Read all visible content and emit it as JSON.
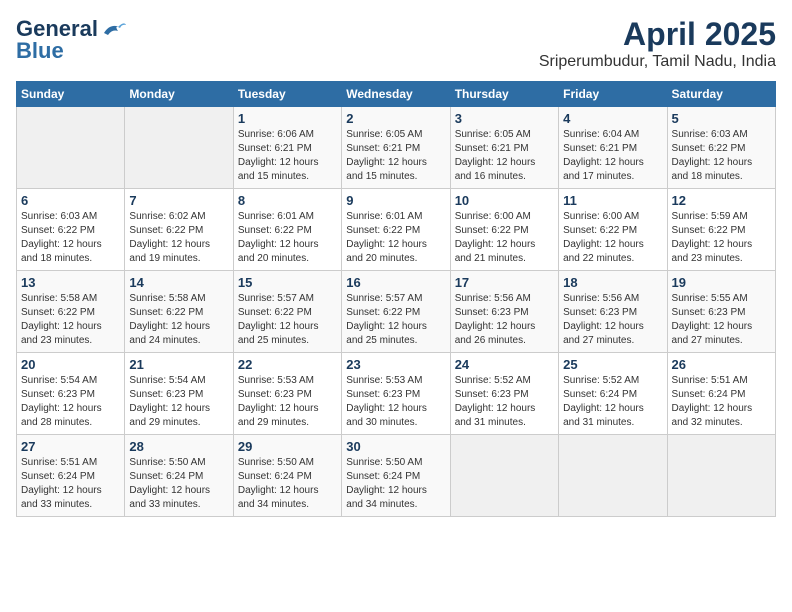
{
  "logo": {
    "line1": "General",
    "line2": "Blue"
  },
  "title": "April 2025",
  "subtitle": "Sriperumbudur, Tamil Nadu, India",
  "weekdays": [
    "Sunday",
    "Monday",
    "Tuesday",
    "Wednesday",
    "Thursday",
    "Friday",
    "Saturday"
  ],
  "weeks": [
    [
      {
        "day": "",
        "info": ""
      },
      {
        "day": "",
        "info": ""
      },
      {
        "day": "1",
        "info": "Sunrise: 6:06 AM\nSunset: 6:21 PM\nDaylight: 12 hours and 15 minutes."
      },
      {
        "day": "2",
        "info": "Sunrise: 6:05 AM\nSunset: 6:21 PM\nDaylight: 12 hours and 15 minutes."
      },
      {
        "day": "3",
        "info": "Sunrise: 6:05 AM\nSunset: 6:21 PM\nDaylight: 12 hours and 16 minutes."
      },
      {
        "day": "4",
        "info": "Sunrise: 6:04 AM\nSunset: 6:21 PM\nDaylight: 12 hours and 17 minutes."
      },
      {
        "day": "5",
        "info": "Sunrise: 6:03 AM\nSunset: 6:22 PM\nDaylight: 12 hours and 18 minutes."
      }
    ],
    [
      {
        "day": "6",
        "info": "Sunrise: 6:03 AM\nSunset: 6:22 PM\nDaylight: 12 hours and 18 minutes."
      },
      {
        "day": "7",
        "info": "Sunrise: 6:02 AM\nSunset: 6:22 PM\nDaylight: 12 hours and 19 minutes."
      },
      {
        "day": "8",
        "info": "Sunrise: 6:01 AM\nSunset: 6:22 PM\nDaylight: 12 hours and 20 minutes."
      },
      {
        "day": "9",
        "info": "Sunrise: 6:01 AM\nSunset: 6:22 PM\nDaylight: 12 hours and 20 minutes."
      },
      {
        "day": "10",
        "info": "Sunrise: 6:00 AM\nSunset: 6:22 PM\nDaylight: 12 hours and 21 minutes."
      },
      {
        "day": "11",
        "info": "Sunrise: 6:00 AM\nSunset: 6:22 PM\nDaylight: 12 hours and 22 minutes."
      },
      {
        "day": "12",
        "info": "Sunrise: 5:59 AM\nSunset: 6:22 PM\nDaylight: 12 hours and 23 minutes."
      }
    ],
    [
      {
        "day": "13",
        "info": "Sunrise: 5:58 AM\nSunset: 6:22 PM\nDaylight: 12 hours and 23 minutes."
      },
      {
        "day": "14",
        "info": "Sunrise: 5:58 AM\nSunset: 6:22 PM\nDaylight: 12 hours and 24 minutes."
      },
      {
        "day": "15",
        "info": "Sunrise: 5:57 AM\nSunset: 6:22 PM\nDaylight: 12 hours and 25 minutes."
      },
      {
        "day": "16",
        "info": "Sunrise: 5:57 AM\nSunset: 6:22 PM\nDaylight: 12 hours and 25 minutes."
      },
      {
        "day": "17",
        "info": "Sunrise: 5:56 AM\nSunset: 6:23 PM\nDaylight: 12 hours and 26 minutes."
      },
      {
        "day": "18",
        "info": "Sunrise: 5:56 AM\nSunset: 6:23 PM\nDaylight: 12 hours and 27 minutes."
      },
      {
        "day": "19",
        "info": "Sunrise: 5:55 AM\nSunset: 6:23 PM\nDaylight: 12 hours and 27 minutes."
      }
    ],
    [
      {
        "day": "20",
        "info": "Sunrise: 5:54 AM\nSunset: 6:23 PM\nDaylight: 12 hours and 28 minutes."
      },
      {
        "day": "21",
        "info": "Sunrise: 5:54 AM\nSunset: 6:23 PM\nDaylight: 12 hours and 29 minutes."
      },
      {
        "day": "22",
        "info": "Sunrise: 5:53 AM\nSunset: 6:23 PM\nDaylight: 12 hours and 29 minutes."
      },
      {
        "day": "23",
        "info": "Sunrise: 5:53 AM\nSunset: 6:23 PM\nDaylight: 12 hours and 30 minutes."
      },
      {
        "day": "24",
        "info": "Sunrise: 5:52 AM\nSunset: 6:23 PM\nDaylight: 12 hours and 31 minutes."
      },
      {
        "day": "25",
        "info": "Sunrise: 5:52 AM\nSunset: 6:24 PM\nDaylight: 12 hours and 31 minutes."
      },
      {
        "day": "26",
        "info": "Sunrise: 5:51 AM\nSunset: 6:24 PM\nDaylight: 12 hours and 32 minutes."
      }
    ],
    [
      {
        "day": "27",
        "info": "Sunrise: 5:51 AM\nSunset: 6:24 PM\nDaylight: 12 hours and 33 minutes."
      },
      {
        "day": "28",
        "info": "Sunrise: 5:50 AM\nSunset: 6:24 PM\nDaylight: 12 hours and 33 minutes."
      },
      {
        "day": "29",
        "info": "Sunrise: 5:50 AM\nSunset: 6:24 PM\nDaylight: 12 hours and 34 minutes."
      },
      {
        "day": "30",
        "info": "Sunrise: 5:50 AM\nSunset: 6:24 PM\nDaylight: 12 hours and 34 minutes."
      },
      {
        "day": "",
        "info": ""
      },
      {
        "day": "",
        "info": ""
      },
      {
        "day": "",
        "info": ""
      }
    ]
  ]
}
